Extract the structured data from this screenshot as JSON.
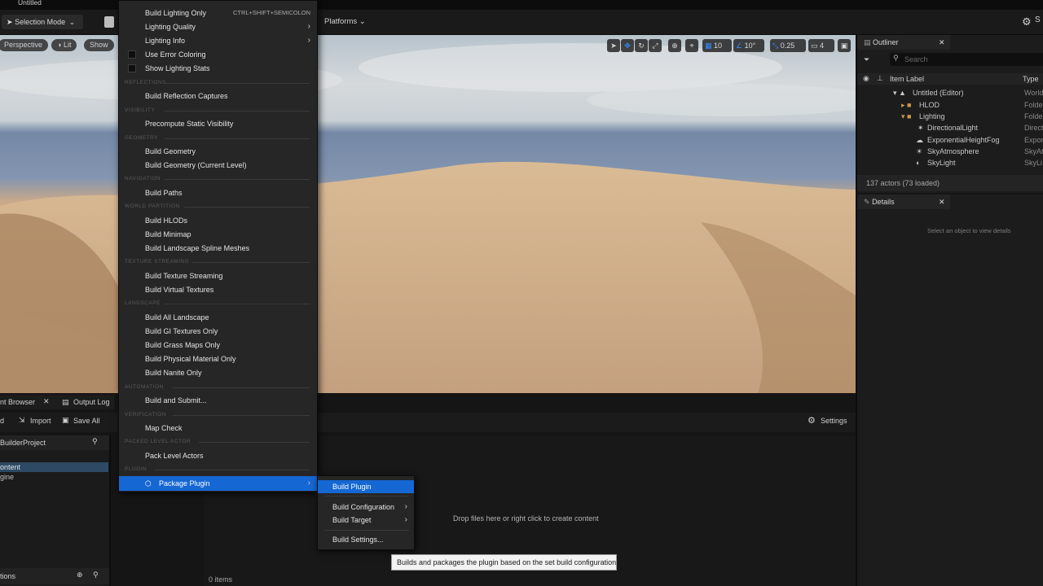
{
  "window": {
    "title": "Untitled"
  },
  "toolbar": {
    "selection_mode": "Selection Mode",
    "platforms": "Platforms",
    "settings_icon": "gear-icon"
  },
  "viewport": {
    "perspective": "Perspective",
    "lit": "Lit",
    "show": "Show",
    "grid_snap": "10",
    "rotation_snap": "10°",
    "scale_snap": "0.25",
    "camera_speed": "4"
  },
  "outliner": {
    "tab": "Outliner",
    "search_placeholder": "Search",
    "col_label": "Item Label",
    "col_type": "Type",
    "rows": [
      {
        "label": "Untitled (Editor)",
        "type": "World"
      },
      {
        "label": "HLOD",
        "type": "Folder"
      },
      {
        "label": "Lighting",
        "type": "Folder"
      },
      {
        "label": "DirectionalLight",
        "type": "Direct"
      },
      {
        "label": "ExponentialHeightFog",
        "type": "Expon"
      },
      {
        "label": "SkyAtmosphere",
        "type": "SkyAt"
      },
      {
        "label": "SkyLight",
        "type": "SkyLi"
      }
    ],
    "status": "137 actors (73 loaded)"
  },
  "details": {
    "tab": "Details",
    "empty": "Select an object to view details"
  },
  "content_browser": {
    "tab_browser": "nt Browser",
    "tab_output": "Output Log",
    "add": "d",
    "import": "Import",
    "save_all": "Save All",
    "settings": "Settings",
    "project": "BuilderProject",
    "tree": [
      "ontent",
      "gine"
    ],
    "drop_hint": "Drop files here or right click to create content",
    "items": "0 items",
    "collections": "tions"
  },
  "menu": {
    "items": [
      {
        "label": "Build Lighting Only",
        "shortcut": "CTRL+SHIFT+SEMICOLON"
      },
      {
        "label": "Lighting Quality",
        "submenu": true
      },
      {
        "label": "Lighting Info",
        "submenu": true
      },
      {
        "label": "Use Error Coloring",
        "check": true
      },
      {
        "label": "Show Lighting Stats",
        "check": true
      },
      {
        "label": "Build Reflection Captures"
      },
      {
        "label": "Precompute Static Visibility"
      },
      {
        "label": "Build Geometry"
      },
      {
        "label": "Build Geometry (Current Level)"
      },
      {
        "label": "Build Paths"
      },
      {
        "label": "Build HLODs"
      },
      {
        "label": "Build Minimap"
      },
      {
        "label": "Build Landscape Spline Meshes"
      },
      {
        "label": "Build Texture Streaming"
      },
      {
        "label": "Build Virtual Textures"
      },
      {
        "label": "Build All Landscape"
      },
      {
        "label": "Build GI Textures Only"
      },
      {
        "label": "Build Grass Maps Only"
      },
      {
        "label": "Build Physical Material Only"
      },
      {
        "label": "Build Nanite Only"
      },
      {
        "label": "Build and Submit..."
      },
      {
        "label": "Map Check"
      },
      {
        "label": "Pack Level Actors"
      },
      {
        "label": "Package Plugin",
        "submenu": true,
        "selected": true
      }
    ],
    "sections": [
      "REFLECTIONS",
      "VISIBILITY",
      "GEOMETRY",
      "NAVIGATION",
      "WORLD PARTITION",
      "TEXTURE STREAMING",
      "LANDSCAPE",
      "AUTOMATION",
      "VERIFICATION",
      "PACKED LEVEL ACTOR",
      "PLUGIN"
    ]
  },
  "submenu": {
    "items": [
      {
        "label": "Build Plugin",
        "selected": true
      },
      {
        "label": "Build Configuration",
        "submenu": true
      },
      {
        "label": "Build Target",
        "submenu": true
      },
      {
        "label": "Build Settings..."
      }
    ]
  },
  "tooltip": "Builds and packages the plugin based on the set build configuration."
}
